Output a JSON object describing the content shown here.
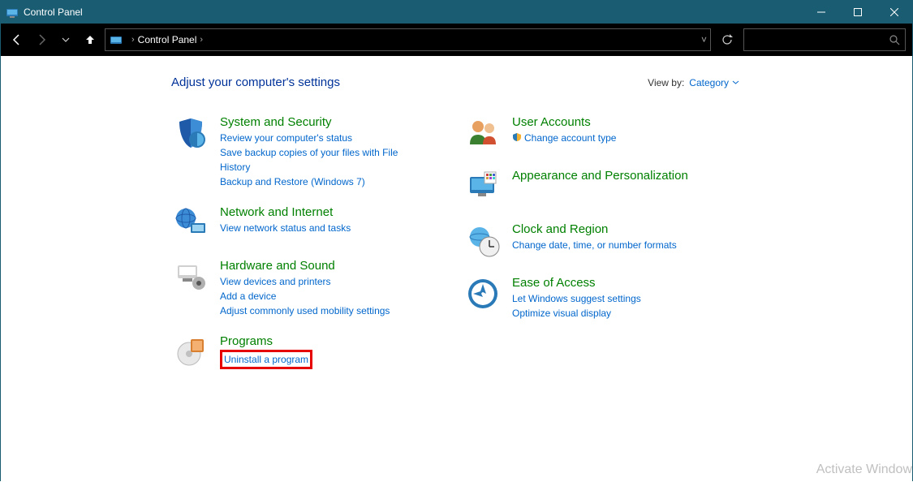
{
  "titlebar": {
    "title": "Control Panel"
  },
  "address": {
    "root": "Control Panel"
  },
  "heading": "Adjust your computer's settings",
  "viewby": {
    "label": "View by:",
    "value": "Category"
  },
  "left": [
    {
      "title": "System and Security",
      "links": [
        "Review your computer's status",
        "Save backup copies of your files with File History",
        "Backup and Restore (Windows 7)"
      ]
    },
    {
      "title": "Network and Internet",
      "links": [
        "View network status and tasks"
      ]
    },
    {
      "title": "Hardware and Sound",
      "links": [
        "View devices and printers",
        "Add a device",
        "Adjust commonly used mobility settings"
      ]
    },
    {
      "title": "Programs",
      "links": [
        "Uninstall a program"
      ]
    }
  ],
  "right": [
    {
      "title": "User Accounts",
      "links": [
        "Change account type"
      ],
      "shield": [
        true
      ]
    },
    {
      "title": "Appearance and Personalization",
      "links": []
    },
    {
      "title": "Clock and Region",
      "links": [
        "Change date, time, or number formats"
      ]
    },
    {
      "title": "Ease of Access",
      "links": [
        "Let Windows suggest settings",
        "Optimize visual display"
      ]
    }
  ],
  "watermark": "Activate Window"
}
